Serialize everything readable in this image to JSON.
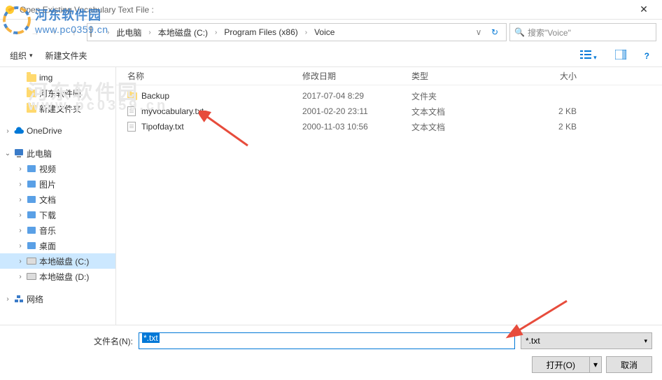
{
  "window": {
    "title": "Open Existing Vocabulary Text File :",
    "close_glyph": "✕"
  },
  "nav": {
    "back_glyph": "←",
    "fwd_glyph": "→",
    "up_glyph": "↑",
    "dropdown_glyph": "∨",
    "refresh_glyph": "↻"
  },
  "breadcrumb": [
    "此电脑",
    "本地磁盘 (C:)",
    "Program Files (x86)",
    "Voice"
  ],
  "search": {
    "placeholder": "搜索\"Voice\"",
    "icon_glyph": "🔍"
  },
  "toolbar": {
    "organize": "组织",
    "new_folder": "新建文件夹",
    "dropdown_glyph": "▾"
  },
  "sidebar": [
    {
      "type": "folder",
      "label": "img",
      "indent": 1,
      "exp": ""
    },
    {
      "type": "folder",
      "label": "河东软件园",
      "indent": 1,
      "exp": ""
    },
    {
      "type": "folder",
      "label": "新建文件夹",
      "indent": 1,
      "exp": ""
    },
    {
      "type": "spacer"
    },
    {
      "type": "cloud",
      "label": "OneDrive",
      "indent": 0,
      "exp": "›"
    },
    {
      "type": "spacer"
    },
    {
      "type": "pc",
      "label": "此电脑",
      "indent": 0,
      "exp": "⌄"
    },
    {
      "type": "lib",
      "label": "视频",
      "indent": 1,
      "exp": "›"
    },
    {
      "type": "lib",
      "label": "图片",
      "indent": 1,
      "exp": "›"
    },
    {
      "type": "lib",
      "label": "文档",
      "indent": 1,
      "exp": "›"
    },
    {
      "type": "lib",
      "label": "下载",
      "indent": 1,
      "exp": "›"
    },
    {
      "type": "lib",
      "label": "音乐",
      "indent": 1,
      "exp": "›"
    },
    {
      "type": "lib",
      "label": "桌面",
      "indent": 1,
      "exp": "›"
    },
    {
      "type": "disk",
      "label": "本地磁盘 (C:)",
      "indent": 1,
      "exp": "›",
      "selected": true
    },
    {
      "type": "disk",
      "label": "本地磁盘 (D:)",
      "indent": 1,
      "exp": "›"
    },
    {
      "type": "spacer"
    },
    {
      "type": "net",
      "label": "网络",
      "indent": 0,
      "exp": "›"
    }
  ],
  "columns": {
    "name": "名称",
    "date": "修改日期",
    "type": "类型",
    "size": "大小"
  },
  "files": [
    {
      "icon": "folder",
      "name": "Backup",
      "date": "2017-07-04 8:29",
      "type": "文件夹",
      "size": ""
    },
    {
      "icon": "file",
      "name": "myvocabulary.txt",
      "date": "2001-02-20 23:11",
      "type": "文本文档",
      "size": "2 KB"
    },
    {
      "icon": "file",
      "name": "Tipofday.txt",
      "date": "2000-11-03 10:56",
      "type": "文本文档",
      "size": "2 KB"
    }
  ],
  "footer": {
    "filename_label": "文件名(N):",
    "filename_value": "*.txt",
    "filter_value": "*.txt",
    "open_label": "打开(O)",
    "cancel_label": "取消",
    "drop_glyph": "▾"
  },
  "watermark": {
    "cn": "河东软件园",
    "url": "www.pc0359.cn",
    "ghost1": "河东软件园",
    "ghost2": "www.pc0359.cn"
  }
}
